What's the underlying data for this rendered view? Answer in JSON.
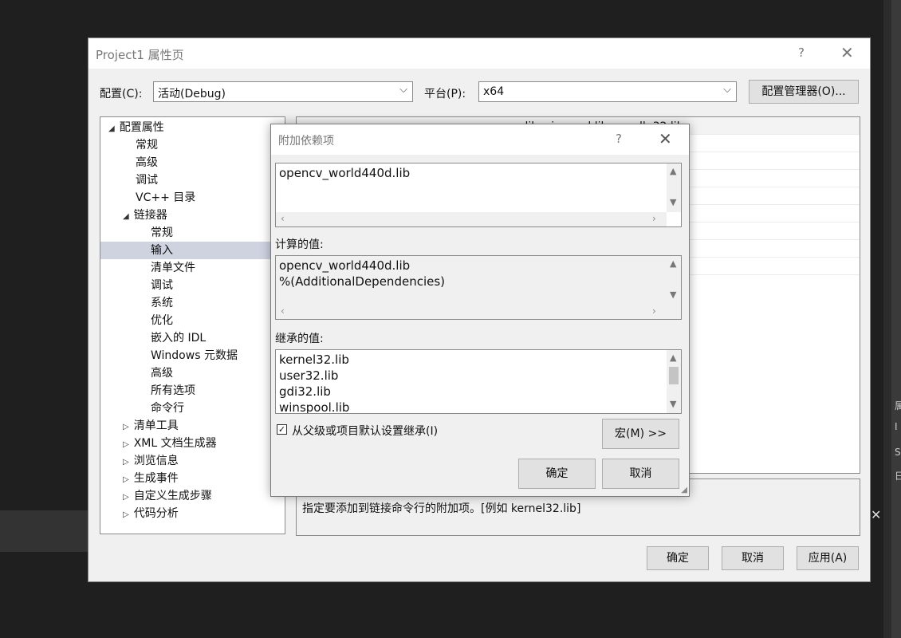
{
  "window": {
    "title": "Project1 属性页",
    "help": "?",
    "close": "✕",
    "config_label": "配置(C):",
    "config_value": "活动(Debug)",
    "platform_label": "平台(P):",
    "platform_value": "x64",
    "config_manager_button": "配置管理器(O)...",
    "ok_button": "确定",
    "cancel_button": "取消",
    "apply_button": "应用(A)"
  },
  "tree": {
    "nodes": [
      {
        "label": "配置属性",
        "expander": "◢"
      },
      {
        "label": "常规",
        "expander": ""
      },
      {
        "label": "高级",
        "expander": ""
      },
      {
        "label": "调试",
        "expander": ""
      },
      {
        "label": "VC++ 目录",
        "expander": ""
      },
      {
        "label": "链接器",
        "expander": "◢"
      },
      {
        "label": "常规",
        "expander": ""
      },
      {
        "label": "输入",
        "expander": ""
      },
      {
        "label": "清单文件",
        "expander": ""
      },
      {
        "label": "调试",
        "expander": ""
      },
      {
        "label": "系统",
        "expander": ""
      },
      {
        "label": "优化",
        "expander": ""
      },
      {
        "label": "嵌入的 IDL",
        "expander": ""
      },
      {
        "label": "Windows 元数据",
        "expander": ""
      },
      {
        "label": "高级",
        "expander": ""
      },
      {
        "label": "所有选项",
        "expander": ""
      },
      {
        "label": "命令行",
        "expander": ""
      },
      {
        "label": "清单工具",
        "expander": "▷"
      },
      {
        "label": "XML 文档生成器",
        "expander": "▷"
      },
      {
        "label": "浏览信息",
        "expander": "▷"
      },
      {
        "label": "生成事件",
        "expander": "▷"
      },
      {
        "label": "自定义生成步骤",
        "expander": "▷"
      },
      {
        "label": "代码分析",
        "expander": "▷"
      }
    ]
  },
  "grid": {
    "first_value": ".lib;winspool.lib;comdlg32.lib"
  },
  "description": "指定要添加到链接命令行的附加项。[例如 kernel32.lib]",
  "dialog": {
    "title": "附加依赖项",
    "help": "?",
    "close": "✕",
    "edit_lines": [
      "opencv_world440d.lib"
    ],
    "computed_label": "计算的值:",
    "computed_lines": [
      "opencv_world440d.lib",
      "%(AdditionalDependencies)"
    ],
    "inherited_label": "继承的值:",
    "inherited_lines": [
      "kernel32.lib",
      "user32.lib",
      "gdi32.lib",
      "winspool.lib"
    ],
    "inherit_checkbox_label": "从父级或项目默认设置继承(I)",
    "inherit_checked": "✓",
    "macro_button": "宏(M) >>",
    "ok_button": "确定",
    "cancel_button": "取消"
  },
  "background": {
    "close_glyph": "✕",
    "side_glyphs": [
      "属",
      "I",
      "S",
      "日"
    ]
  }
}
